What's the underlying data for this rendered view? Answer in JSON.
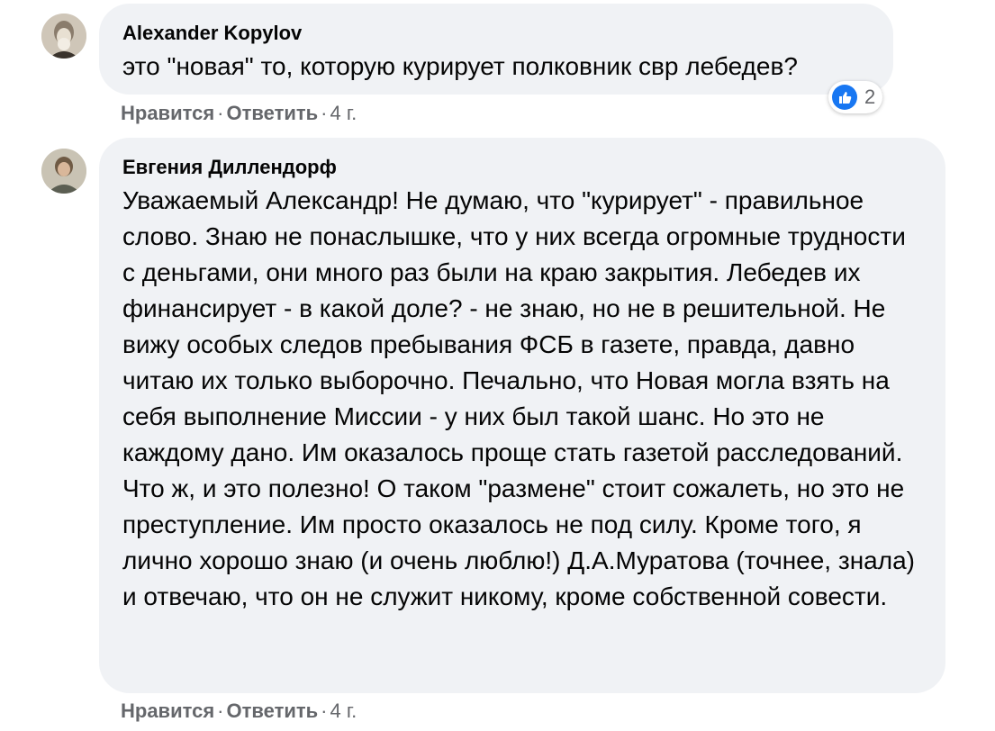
{
  "comments": [
    {
      "author": "Alexander Kopylov",
      "text": "это \"новая\" то, которую курирует полковник свр лебедев?",
      "like_label": "Нравится",
      "reply_label": "Ответить",
      "separator": "·",
      "time": "4 г.",
      "reaction_count": "2",
      "reaction_icon": "like-icon"
    },
    {
      "author": "Евгения Диллендорф",
      "text": "Уважаемый Александр! Не думаю, что \"курирует\" - правильное слово. Знаю не понаслышке, что у них всегда огромные трудности с деньгами, они много раз были на краю закрытия. Лебедев их финансирует - в какой доле? - не знаю, но не в решительной. Не вижу особых следов пребывания ФСБ в газете, правда, давно читаю их только выборочно. Печально, что Новая могла взять на себя выполнение Миссии - у них был такой шанс. Но это не каждому дано. Им оказалось проще стать газетой расследований. Что ж, и это полезно! О таком \"размене\" стоит сожалеть, но это не преступление. Им просто оказалось не под силу. Кроме того, я лично хорошо знаю (и очень люблю!) Д.А.Муратова (точнее, знала) и отвечаю, что он не служит никому, кроме собственной совести.",
      "like_label": "Нравится",
      "reply_label": "Ответить",
      "separator": "·",
      "time": "4 г."
    }
  ],
  "colors": {
    "bubble": "#f0f2f5",
    "meta": "#65676b",
    "like_blue": "#1877f2"
  }
}
